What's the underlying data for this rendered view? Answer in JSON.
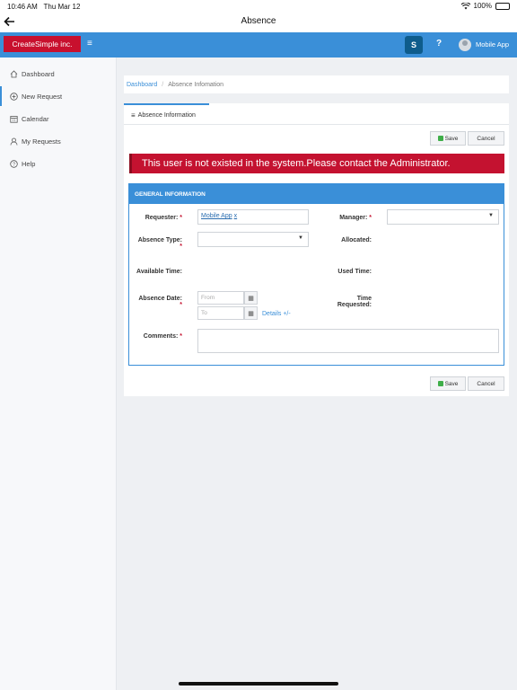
{
  "status": {
    "time": "10:46 AM",
    "date": "Thu Mar 12",
    "battery": "100%"
  },
  "nav": {
    "title": "Absence",
    "back_icon": "arrow-left-icon"
  },
  "appbar": {
    "logo_text": "CreateSimple inc.",
    "menu_icon": "≡",
    "sharepoint_icon_text": "S",
    "help_text": "?",
    "user_name": "Mobile App"
  },
  "sidebar": {
    "items": [
      {
        "label": "Dashboard",
        "icon": "home-icon"
      },
      {
        "label": "New Request",
        "icon": "plus-circle-icon"
      },
      {
        "label": "Calendar",
        "icon": "calendar-icon"
      },
      {
        "label": "My Requests",
        "icon": "user-icon"
      },
      {
        "label": "Help",
        "icon": "question-circle-icon"
      }
    ]
  },
  "breadcrumb": {
    "home": "Dashboard",
    "separator": "/",
    "current": "Absence Infomation"
  },
  "tab": {
    "label": "Absence Information"
  },
  "buttons": {
    "save": "Save",
    "cancel": "Cancel"
  },
  "alert": {
    "message": "This user is not existed in the system.Please contact the Administrator."
  },
  "section": {
    "title": "GENERAL INFORMATION",
    "requester_label": "Requester:",
    "requester_value": "Mobile App",
    "requester_remove": "x",
    "manager_label": "Manager:",
    "absence_type_label": "Absence Type:",
    "allocated_label": "Allocated:",
    "available_time_label": "Available Time:",
    "used_time_label": "Used Time:",
    "absence_date_label": "Absence Date:",
    "from_placeholder": "From",
    "to_placeholder": "To",
    "details_link": "Details +/-",
    "time_requested_label_1": "Time",
    "time_requested_label_2": "Requested:",
    "comments_label": "Comments:",
    "required_mark": "*"
  }
}
